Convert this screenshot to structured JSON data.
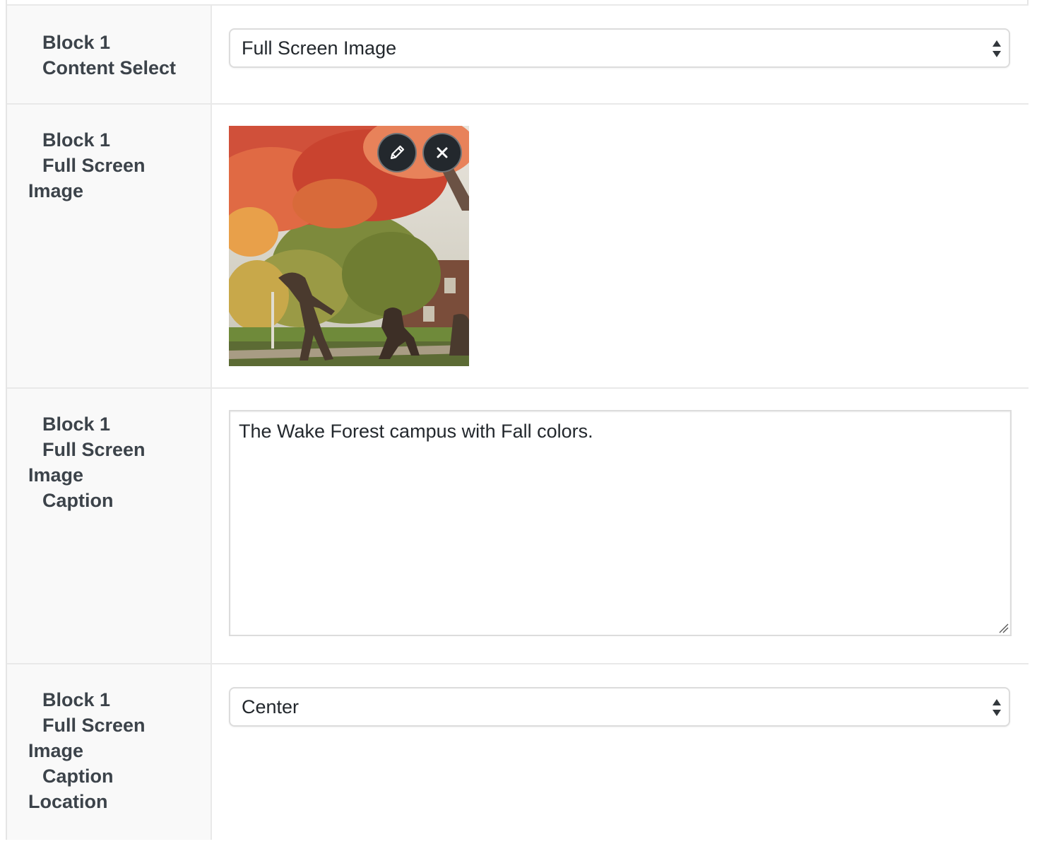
{
  "rows": [
    {
      "label_lines": [
        "Block 1",
        "Content Select"
      ],
      "select_value": "Full Screen Image"
    },
    {
      "label_lines": [
        "Block 1",
        "Full Screen",
        "Image"
      ],
      "image_alt": "Wake Forest campus autumn trees with sculptures",
      "edit_icon": "pencil-icon",
      "remove_icon": "close-icon"
    },
    {
      "label_lines": [
        "Block 1",
        "Full Screen",
        "Image",
        "Caption"
      ],
      "textarea_value": "The Wake Forest campus with Fall colors."
    },
    {
      "label_lines": [
        "Block 1",
        "Full Screen",
        "Image",
        "Caption",
        "Location"
      ],
      "select_value": "Center"
    }
  ],
  "colors": {
    "label_bg": "#f9f9f9",
    "border": "#e9e9e9",
    "text": "#3c434a",
    "button_dark": "#23282d"
  }
}
